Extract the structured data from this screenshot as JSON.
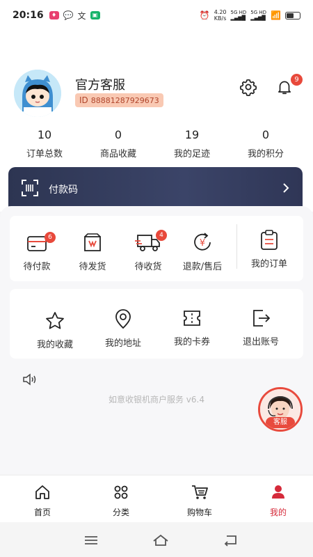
{
  "status_bar": {
    "time": "20:16",
    "net_speed_value": "4.20",
    "net_speed_unit": "KB/s",
    "sim1": "5G HD",
    "sim2": "5G HD",
    "battery_level": 0.6
  },
  "profile": {
    "name": "官方客服",
    "id_prefix": "ID",
    "id_value": "88881287929673",
    "notification_count": "9"
  },
  "stats": [
    {
      "value": "10",
      "label": "订单总数"
    },
    {
      "value": "0",
      "label": "商品收藏"
    },
    {
      "value": "19",
      "label": "我的足迹"
    },
    {
      "value": "0",
      "label": "我的积分"
    }
  ],
  "pay_code": {
    "label": "付款码"
  },
  "orders": [
    {
      "label": "待付款",
      "badge": "6",
      "icon": "wallet-icon"
    },
    {
      "label": "待发货",
      "badge": "",
      "icon": "package-icon"
    },
    {
      "label": "待收货",
      "badge": "4",
      "icon": "truck-icon"
    },
    {
      "label": "退款/售后",
      "badge": "",
      "icon": "refund-icon"
    },
    {
      "label": "我的订单",
      "badge": "",
      "icon": "clipboard-icon"
    }
  ],
  "tools": [
    {
      "label": "我的收藏",
      "icon": "star-icon"
    },
    {
      "label": "我的地址",
      "icon": "location-pin-icon"
    },
    {
      "label": "我的卡券",
      "icon": "ticket-icon"
    },
    {
      "label": "退出账号",
      "icon": "logout-icon"
    }
  ],
  "version": "如意收银机商户服务 v6.4",
  "customer_service": {
    "label": "客服"
  },
  "tabbar": [
    {
      "label": "首页",
      "icon": "home-icon",
      "active": false
    },
    {
      "label": "分类",
      "icon": "grid-icon",
      "active": false
    },
    {
      "label": "购物车",
      "icon": "cart-icon",
      "active": false
    },
    {
      "label": "我的",
      "icon": "user-icon",
      "active": true
    }
  ],
  "colors": {
    "accent": "#d52a3a",
    "badge": "#e8493b",
    "paycode_bg": "#2d3552",
    "id_badge_bg": "#f9c9b3"
  }
}
